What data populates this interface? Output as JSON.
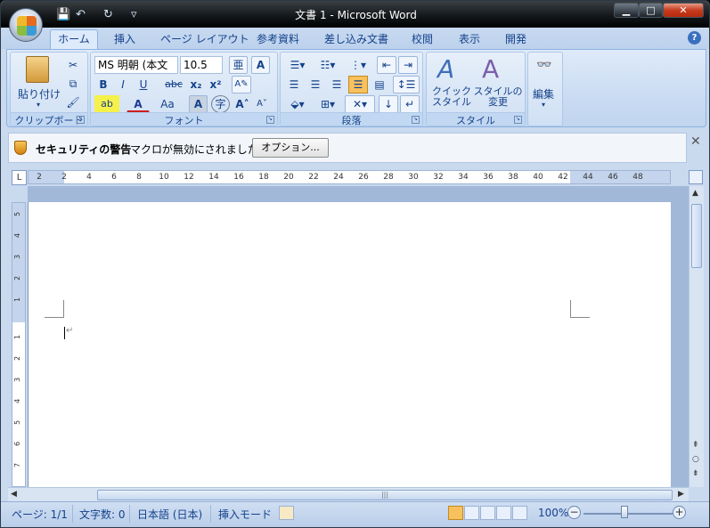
{
  "window": {
    "title": "文書 1 - Microsoft Word",
    "min_label": "▁",
    "max_label": "□",
    "close_label": "✕"
  },
  "qat": {
    "save": "💾",
    "undo": "↶",
    "redo": "↻",
    "more": "▿"
  },
  "tabs": [
    {
      "label": "ホーム"
    },
    {
      "label": "挿入"
    },
    {
      "label": "ページ レイアウト"
    },
    {
      "label": "参考資料"
    },
    {
      "label": "差し込み文書"
    },
    {
      "label": "校閲"
    },
    {
      "label": "表示"
    },
    {
      "label": "開発"
    }
  ],
  "help": "?",
  "ribbon": {
    "clipboard": {
      "label": "クリップボード",
      "paste": "貼り付け"
    },
    "font": {
      "label": "フォント",
      "font_name": "MS 明朝 (本文",
      "font_size": "10.5"
    },
    "paragraph": {
      "label": "段落"
    },
    "styles": {
      "label": "スタイル",
      "quick": "クイック\nスタイル",
      "change": "スタイルの\n変更"
    },
    "edit": {
      "label": "編集"
    }
  },
  "security": {
    "title": "セキュリティの警告",
    "message": "マクロが無効にされました。",
    "options": "オプション..."
  },
  "ruler": {
    "corner": "L",
    "h": [
      "2",
      "2",
      "4",
      "6",
      "8",
      "10",
      "12",
      "14",
      "16",
      "18",
      "20",
      "22",
      "24",
      "26",
      "28",
      "30",
      "32",
      "34",
      "36",
      "38",
      "40",
      "42",
      "44",
      "46",
      "48"
    ],
    "v": [
      "5",
      "4",
      "3",
      "2",
      "1",
      "1",
      "2",
      "3",
      "4",
      "5",
      "6",
      "7"
    ]
  },
  "document": {
    "para_mark": "↵"
  },
  "statusbar": {
    "page": "ページ: 1/1",
    "words": "文字数: 0",
    "language": "日本語 (日本)",
    "mode": "挿入モード",
    "zoom": "100%",
    "zoom_minus": "−",
    "zoom_plus": "+"
  }
}
